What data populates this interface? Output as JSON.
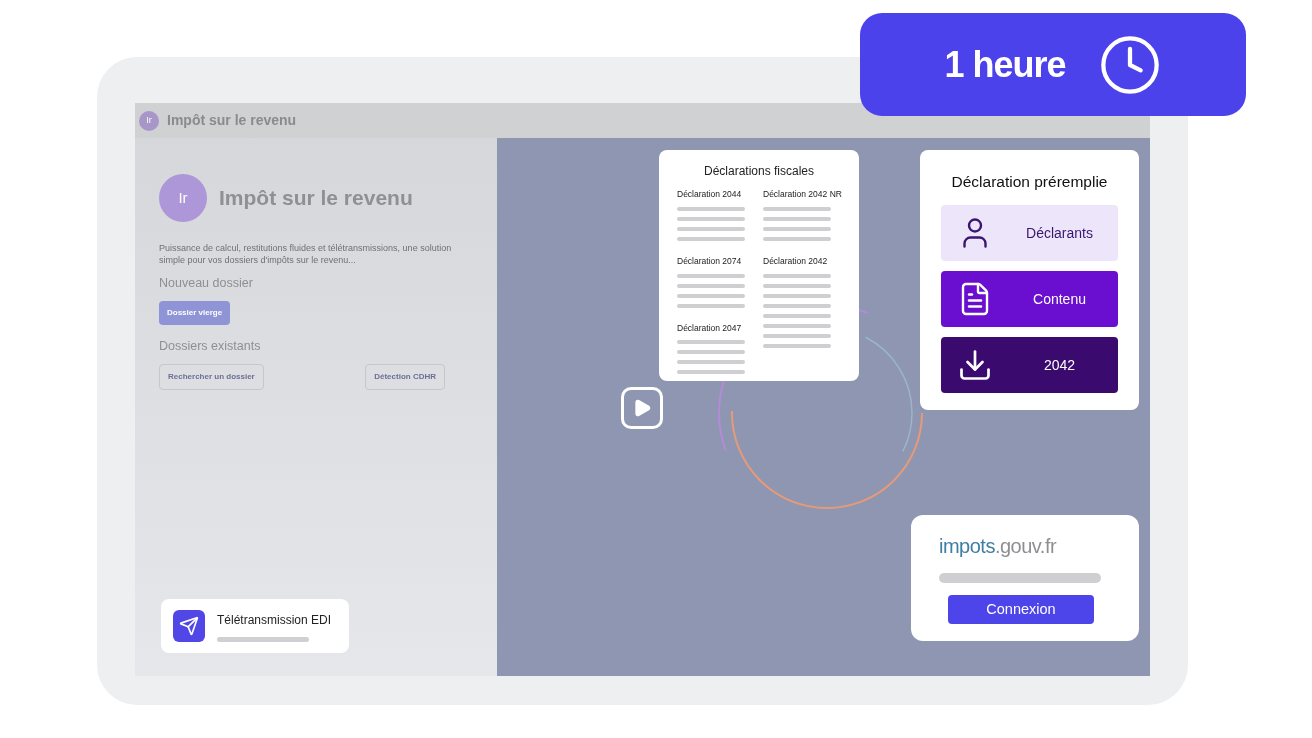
{
  "badge": {
    "label": "1 heure"
  },
  "app": {
    "header": {
      "logo": "Ir",
      "title": "Impôt sur le revenu"
    },
    "hero": {
      "logo": "Ir",
      "title": "Impôt sur le revenu"
    },
    "description": "Puissance de calcul, restitutions fluides et télétransmissions, une solution simple pour vos dossiers d'impôts sur le revenu...",
    "new_section": {
      "title": "Nouveau dossier",
      "button": "Dossier vierge"
    },
    "existing_section": {
      "title": "Dossiers existants",
      "buttons": [
        "Rechercher un dossier",
        "Détection CDHR"
      ]
    }
  },
  "edi_card": {
    "title": "Télétransmission EDI"
  },
  "fiscal_card": {
    "title": "Déclarations fiscales",
    "columns": [
      [
        {
          "title": "Déclaration 2044"
        },
        {
          "title": "Déclaration 2074"
        },
        {
          "title": "Déclaration 2047"
        }
      ],
      [
        {
          "title": "Déclaration 2042 NR"
        },
        {
          "title": "Déclaration 2042"
        }
      ]
    ]
  },
  "prefill_card": {
    "title": "Déclaration préremplie",
    "items": [
      {
        "label": "Déclarants",
        "kind": "light"
      },
      {
        "label": "Contenu",
        "kind": "medium"
      },
      {
        "label": "2042",
        "kind": "dark"
      }
    ]
  },
  "login_card": {
    "logo_main": "impots",
    "logo_suffix": ".gouv.fr",
    "button": "Connexion"
  }
}
